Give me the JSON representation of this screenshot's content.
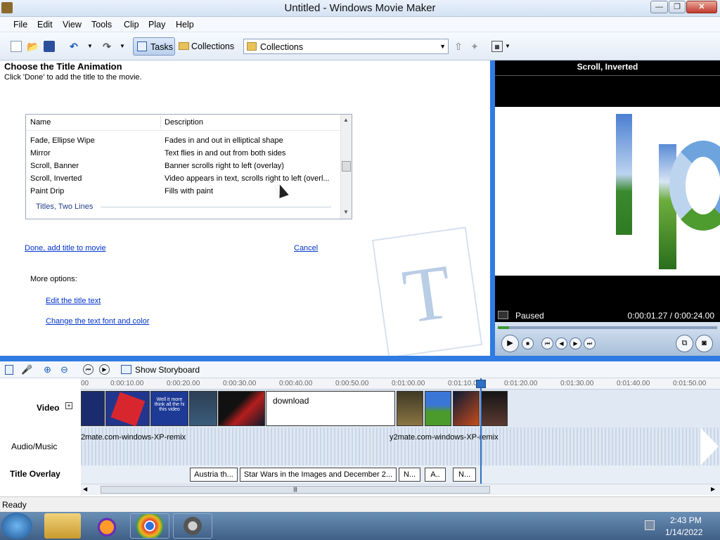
{
  "window": {
    "title": "Untitled - Windows Movie Maker"
  },
  "menu": [
    "File",
    "Edit",
    "View",
    "Tools",
    "Clip",
    "Play",
    "Help"
  ],
  "toolbar": {
    "tasks_label": "Tasks",
    "collections_label": "Collections",
    "combo_value": "Collections"
  },
  "task": {
    "heading": "Choose the Title Animation",
    "instruction": "Click 'Done' to add the title to the movie.",
    "list_header": {
      "name": "Name",
      "description": "Description"
    },
    "rows": [
      {
        "name": "Fade, Ellipse Wipe",
        "description": "Fades in and out in elliptical shape"
      },
      {
        "name": "Mirror",
        "description": "Text flies in and out from both sides"
      },
      {
        "name": "Scroll, Banner",
        "description": "Banner scrolls right to left (overlay)"
      },
      {
        "name": "Scroll, Inverted",
        "description": "Video appears in text, scrolls right to left (overl..."
      },
      {
        "name": "Paint Drip",
        "description": "Fills with paint"
      }
    ],
    "group_label": "Titles, Two Lines",
    "done_link": "Done, add title to movie",
    "cancel_link": "Cancel",
    "more_options": "More options:",
    "edit_text_link": "Edit the title text",
    "font_color_link": "Change the text font and color"
  },
  "preview": {
    "title": "Scroll, Inverted",
    "status": "Paused",
    "time": "0:00:01.27 / 0:00:24.00",
    "progress": 0.05
  },
  "timeline": {
    "storyboard_label": "Show Storyboard",
    "ruler_ticks": [
      "00",
      "0:00:10.00",
      "0:00:20.00",
      "0:00:30.00",
      "0:00:40.00",
      "0:00:50.00",
      "0:01:00.00",
      "0:01:10.00",
      "0:01:20.00",
      "0:01:30.00",
      "0:01:40.00",
      "0:01:50.00"
    ],
    "video_label": "Video",
    "audio_label": "Audio/Music",
    "title_label": "Title Overlay",
    "video_clip_labels": [
      "Well it more think all the hi this video",
      "download"
    ],
    "audio_clips": [
      "2mate.com-windows-XP-remix",
      "y2mate.com-windows-XP-remix"
    ],
    "title_clips": [
      "Austria th...",
      "Star Wars in the Images and December 2...",
      "N...",
      "A..",
      "N..."
    ]
  },
  "status": {
    "text": "Ready"
  },
  "taskbar": {
    "time": "2:43 PM",
    "date": "1/14/2022"
  }
}
